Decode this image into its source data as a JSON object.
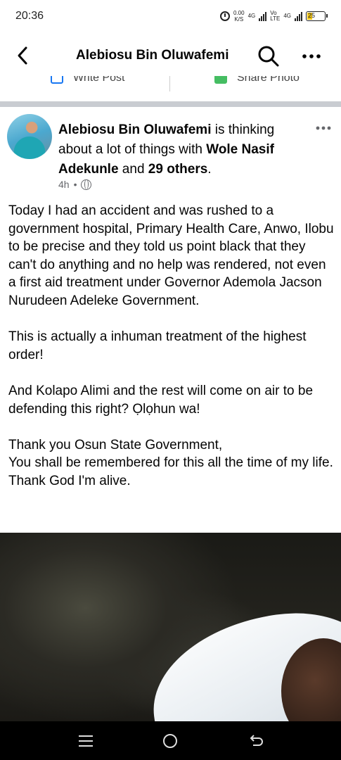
{
  "status_bar": {
    "time": "20:36",
    "speed_value": "0.00",
    "speed_unit": "K/S",
    "net1": "4G",
    "volte_top": "Vo",
    "volte_bottom": "LTE",
    "net2": "4G",
    "battery": "25"
  },
  "header": {
    "title": "Alebiosu Bin Oluwafemi",
    "back_icon": "back-arrow-icon",
    "search_icon": "search-icon",
    "more_icon": "more-dots-icon"
  },
  "composer": {
    "write_label": "Write Post",
    "photo_label": "Share Photo"
  },
  "post": {
    "author": "Alebiosu Bin Oluwafemi",
    "thinking_text": " is thinking about a lot of things with ",
    "tagged": "Wole Nasif Adekunle",
    "and_text": " and ",
    "others": "29 others",
    "period": ".",
    "time": "4h",
    "time_sep": "•",
    "privacy_icon": "globe-icon",
    "paragraphs": [
      "Today I had an accident and was rushed to a government hospital, Primary Health Care, Anwo, Ilobu to be precise and they told us point black that they can't do anything and no help was rendered, not even a first aid treatment under Governor Ademola Jacson Nurudeen Adeleke Government.",
      "This is actually a inhuman treatment of the highest order!",
      "And Kolapo Alimi and the rest will come on air to be defending this right? Ọlọhun wa!",
      "Thank you Osun State Government,",
      "You shall be remembered for this all the time of my life.",
      "Thank God I'm alive."
    ]
  },
  "nav": {
    "menu_icon": "recent-apps-icon",
    "home_icon": "home-icon",
    "back_icon": "back-icon"
  },
  "colors": {
    "accent": "#1877f2",
    "text": "#050505",
    "secondary": "#65676b",
    "separator": "#c9ccd1"
  }
}
